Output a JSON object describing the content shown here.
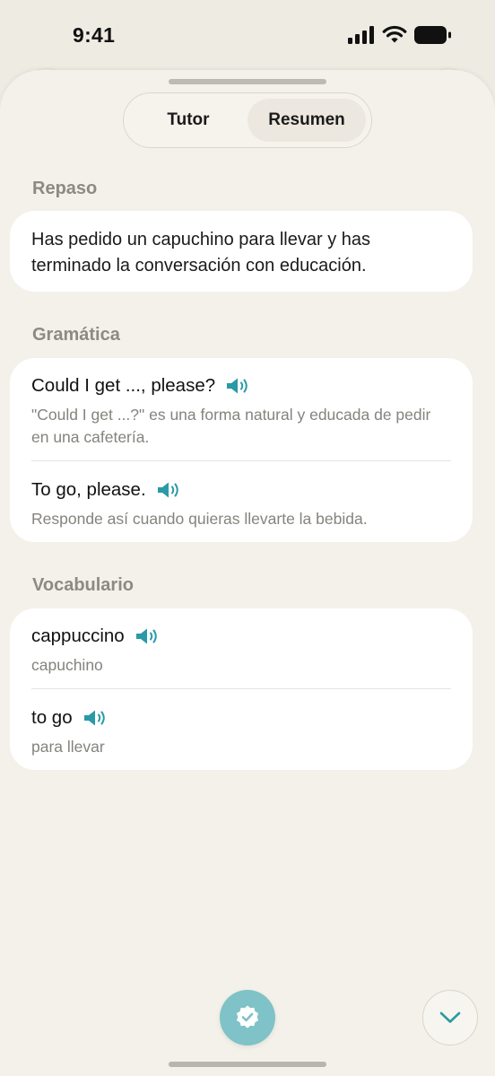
{
  "status_bar": {
    "time": "9:41"
  },
  "tabs": [
    {
      "label": "Tutor",
      "active": false
    },
    {
      "label": "Resumen",
      "active": true
    }
  ],
  "review": {
    "title": "Repaso",
    "text": "Has pedido un capuchino para llevar y has terminado la conversación con educación."
  },
  "grammar": {
    "title": "Gramática",
    "items": [
      {
        "phrase": "Could I get ..., please?",
        "explanation": "\"Could I get ...?\" es una forma natural y educada de pedir en una cafetería."
      },
      {
        "phrase": "To go, please.",
        "explanation": "Responde así cuando quieras llevarte la bebida."
      }
    ]
  },
  "vocabulary": {
    "title": "Vocabulario",
    "items": [
      {
        "word": "cappuccino",
        "translation": "capuchino"
      },
      {
        "word": "to go",
        "translation": "para llevar"
      }
    ]
  },
  "icons": {
    "speaker": "speaker-icon",
    "done": "verified-badge-icon",
    "scroll": "chevron-down-icon"
  },
  "colors": {
    "accent": "#2a9aa5",
    "done_button": "#7fc2c7",
    "background": "#eeebe3",
    "sheet": "#f3f1ea"
  }
}
